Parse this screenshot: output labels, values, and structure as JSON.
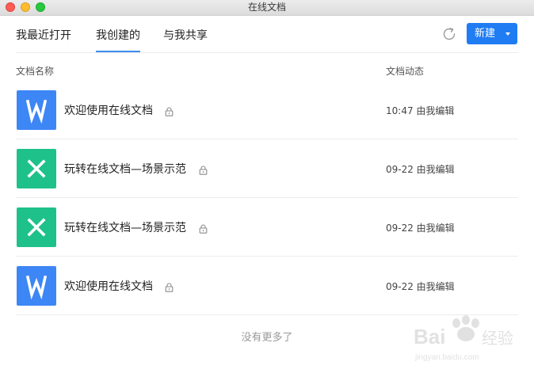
{
  "window": {
    "title": "在线文档"
  },
  "tabs": [
    {
      "label": "我最近打开",
      "active": false
    },
    {
      "label": "我创建的",
      "active": true
    },
    {
      "label": "与我共享",
      "active": false
    }
  ],
  "toolbar": {
    "refresh_icon": "refresh-icon",
    "new_label": "新建",
    "accent_color": "#1f7cf2"
  },
  "columns": {
    "name": "文档名称",
    "activity": "文档动态"
  },
  "documents": [
    {
      "type": "word",
      "icon_letter": "W",
      "icon_color": "#3d86f5",
      "name": "欢迎使用在线文档",
      "activity": "10:47 由我编辑",
      "locked": true
    },
    {
      "type": "excel",
      "icon_letter": "X",
      "icon_color": "#1fc18a",
      "name": "玩转在线文档—场景示范",
      "activity": "09-22 由我编辑",
      "locked": true
    },
    {
      "type": "excel",
      "icon_letter": "X",
      "icon_color": "#1fc18a",
      "name": "玩转在线文档—场景示范",
      "activity": "09-22 由我编辑",
      "locked": true
    },
    {
      "type": "word",
      "icon_letter": "W",
      "icon_color": "#3d86f5",
      "name": "欢迎使用在线文档",
      "activity": "09-22 由我编辑",
      "locked": true
    }
  ],
  "footer": {
    "no_more": "没有更多了"
  },
  "watermark": {
    "brand": "Baidu经验",
    "url": "jingyan.baidu.com"
  }
}
